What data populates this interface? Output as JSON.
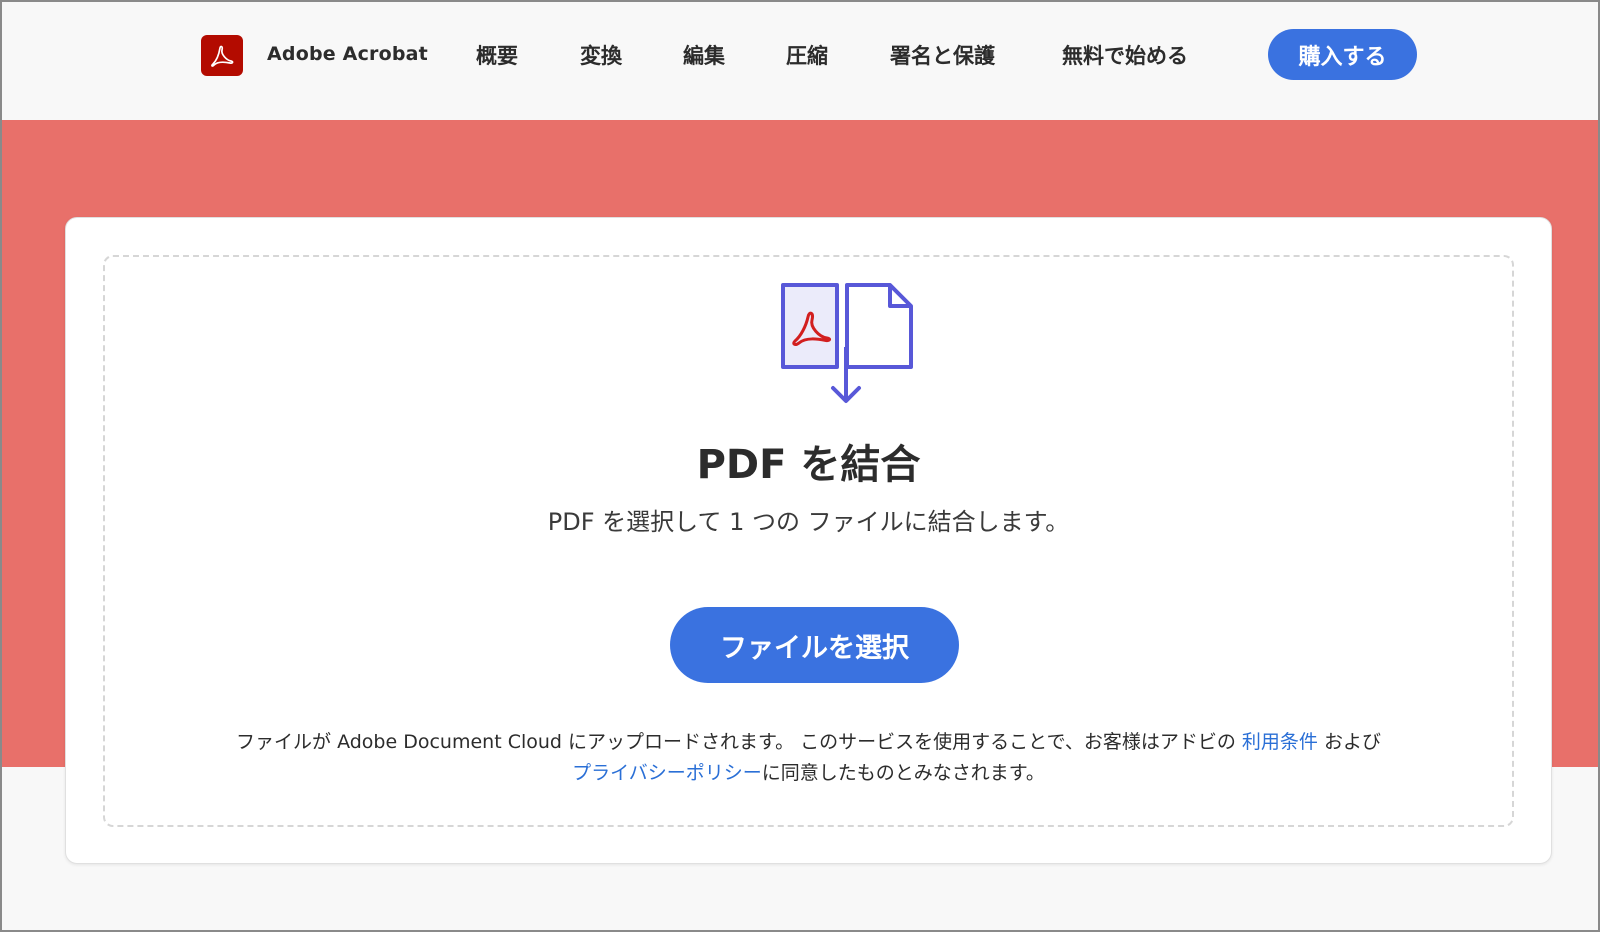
{
  "header": {
    "brand": "Adobe Acrobat",
    "nav": [
      "概要",
      "変換",
      "編集",
      "圧縮",
      "署名と保護",
      "無料で始める"
    ],
    "buy_label": "購入する",
    "logo_icon": "acrobat-logo-icon"
  },
  "main": {
    "title": "PDF を結合",
    "subtitle": "PDF を選択して 1 つの ファイルに結合します。",
    "select_button": "ファイルを選択",
    "legal": {
      "line1_prefix": "ファイルが Adobe Document Cloud にアップロードされます。 このサービスを使用することで、お客様はアドビの",
      "terms_link": "利用条件",
      "line1_suffix": "および",
      "privacy_link": "プライバシーポリシー",
      "line2_suffix": "に同意したものとみなされます。"
    },
    "illustration_icon": "combine-files-icon"
  },
  "colors": {
    "accent": "#3a72e0",
    "hero_band": "#e8706a",
    "brand_red": "#b30b00",
    "icon_purple": "#5858d8",
    "link": "#2a6fd6"
  }
}
